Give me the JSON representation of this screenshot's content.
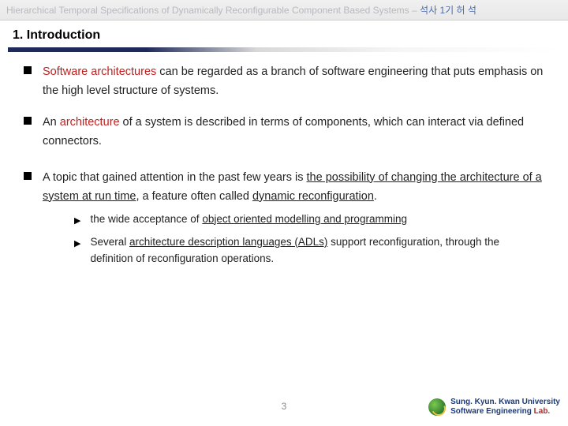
{
  "header": {
    "title_en": "Hierarchical Temporal Specifications of Dynamically Reconfigurable Component Based Systems",
    "separator": " – ",
    "title_ko": "석사 1기 허 석"
  },
  "section": {
    "number": "1.",
    "title": "Introduction"
  },
  "bullets": [
    {
      "pre": "",
      "highlight": "Software architectures",
      "post": " can be regarded as a branch of software engineering that puts emphasis on the high level structure of systems."
    },
    {
      "pre": "An ",
      "highlight": "architecture",
      "post": " of a system is described in terms of components, which can interact via defined connectors."
    },
    {
      "pre": "A topic that gained attention in the past few years is ",
      "u1": "the possibility of changing the architecture of a system at run time",
      "mid": ", a feature often called ",
      "u2": "dynamic reconfiguration",
      "post": "."
    }
  ],
  "subs": [
    {
      "pre": "the wide acceptance of ",
      "u": "object oriented modelling and programming",
      "post": ""
    },
    {
      "pre": "Several ",
      "u": "architecture description languages (ADLs)",
      "post": " support reconfiguration, through the definition of reconfiguration operations."
    }
  ],
  "footer": {
    "page": "3",
    "uni1": "Sung. Kyun. Kwan University",
    "uni2a": "Software Engineering ",
    "uni2b": "Lab."
  }
}
